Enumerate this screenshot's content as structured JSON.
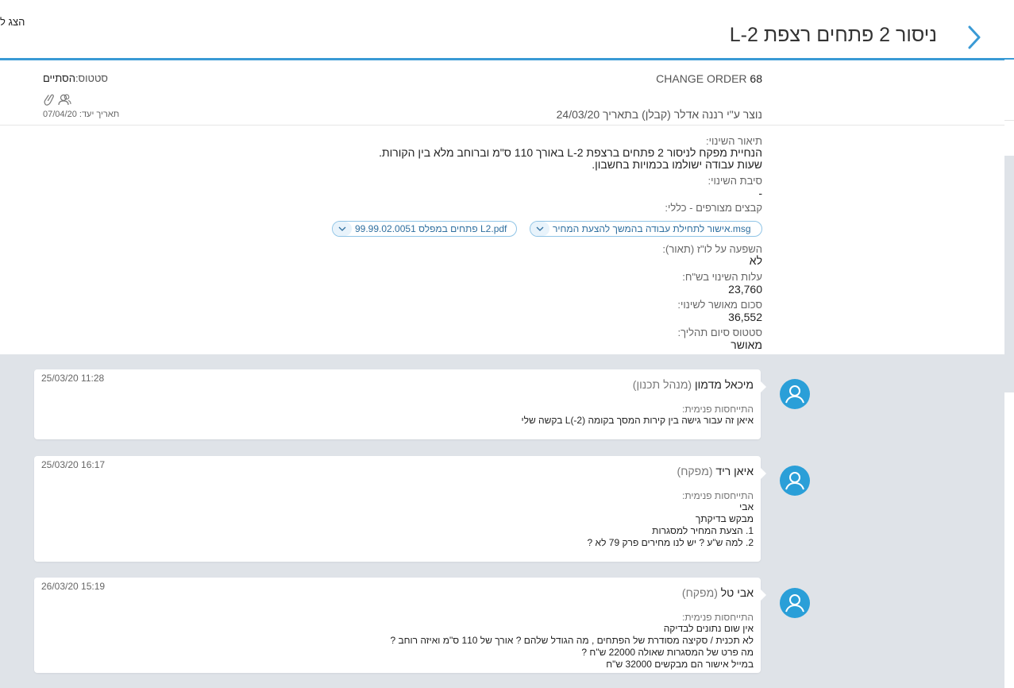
{
  "header": {
    "top_left_link": "הצג ל",
    "title": "ניסור 2 פתחים רצפת L-2"
  },
  "info": {
    "change_order_label": "CHANGE ORDER",
    "change_order_number": "68",
    "status_label": "סטטוס:",
    "status_value": "הסתיים",
    "created_text": "נוצר ע\"י רננה אדלר (קבלן) בתאריך 24/03/20",
    "due_label": "תאריך יעד:",
    "due_value": "07/04/20"
  },
  "details": {
    "description_label": "תיאור השינוי:",
    "description_lines": [
      "הנחיית מפקח לניסור 2 פתחים ברצפת L-2 באורך 110 ס\"מ וברוחב מלא בין הקורות.",
      "שעות עבודה ישולמו בכמויות בחשבון."
    ],
    "reason_label": "סיבת השינוי:",
    "reason_value": "-",
    "attachments_label": "קבצים מצורפים - כללי:",
    "attachments": [
      "אישור לתחילת עבודה בהמשך להצעת המחיר.msg",
      "99.99.02.0051 פתחים במפלס L2.pdf"
    ],
    "schedule_impact_label": "השפעה על לו\"ז (תאור):",
    "schedule_impact_value": "לא",
    "cost_label": "עלות השינוי בש\"ח:",
    "cost_value": "23,760",
    "approved_label": "סכום מאושר לשינוי:",
    "approved_value": "36,552",
    "process_status_label": "סטטוס סיום תהליך:",
    "process_status_value": "מאושר"
  },
  "comments": [
    {
      "author": "מיכאל מדמון",
      "role": "(מנהל תכנון)",
      "timestamp": "25/03/20 11:28",
      "label": "התייחסות פנימית:",
      "lines": [
        "איאן זה עבור גישה בין קירות המסך בקומה (L(-2 בקשה שלי"
      ]
    },
    {
      "author": "איאן ריד",
      "role": "(מפקח)",
      "timestamp": "25/03/20 16:17",
      "label": "התייחסות פנימית:",
      "lines": [
        "אבי",
        "מבקש בדיקתך",
        "1. הצעת המחיר למסגרות",
        "2. למה ש\"ע ? יש לנו מחירים פרק 79 לא ?"
      ]
    },
    {
      "author": "אבי טל",
      "role": "(מפקח)",
      "timestamp": "26/03/20 15:19",
      "label": "התייחסות פנימית:",
      "lines": [
        "אין שום נתונים לבדיקה",
        "לא תכנית / סקיצה מסודרת של הפתחים , מה הגודל שלהם ? אורך של 110 ס\"מ ואיזה רוחב ?",
        "מה פרט של המסגרות שאולה 22000 ש\"ח ?",
        "במייל אישור הם מבקשים 32000 ש\"ח"
      ]
    }
  ],
  "colors": {
    "accent": "#3a9ad5",
    "avatar": "#2a9fd8",
    "comments_background": "#dfe3e8",
    "chip_border": "#8fc4e6"
  },
  "icons": {
    "back": "chevron-right-icon",
    "attachment": "paperclip-icon",
    "users": "users-icon",
    "avatar": "user-avatar-icon",
    "chip": "chevron-down-icon"
  }
}
